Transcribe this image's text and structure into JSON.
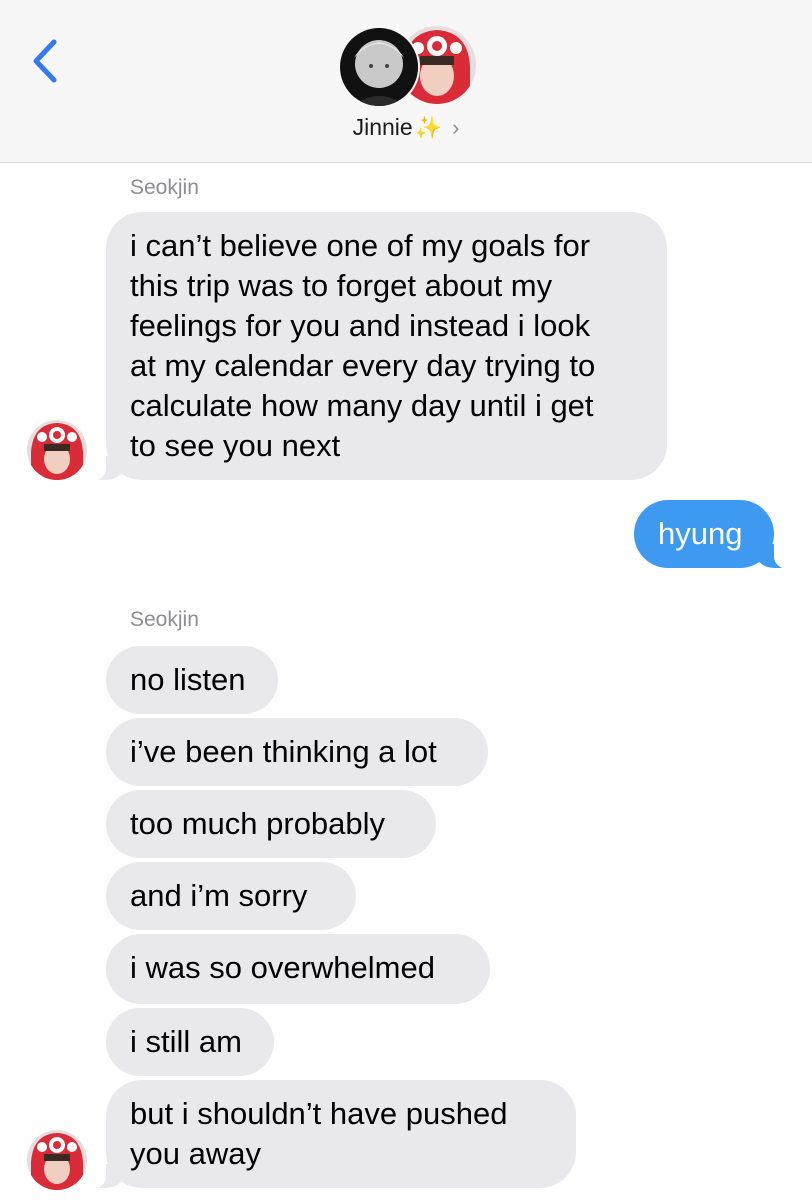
{
  "header": {
    "contact_name": "Jinnie",
    "sparkle": "✨",
    "chevron": "›",
    "back_icon": "chevron-left-icon"
  },
  "colors": {
    "header_bg": "#f7f7f7",
    "incoming_bubble": "#e9e9eb",
    "outgoing_bubble": "#3d9af0",
    "back_accent": "#3478f6",
    "sender_label": "#8e8e93"
  },
  "messages": {
    "group1_sender": "Seokjin",
    "group1_lines": [
      "i can’t believe one of my goals for",
      "this trip was to forget about my",
      "feelings for you and instead i look",
      "at my calendar every day trying to",
      "calculate how many day until i get",
      "to see you next"
    ],
    "sent_1": "hyung",
    "group2_sender": "Seokjin",
    "group2": [
      "no listen",
      "i’ve been thinking a lot",
      "too much probably",
      "and i’m sorry",
      "i was so overwhelmed",
      "i still am"
    ],
    "last_lines": [
      "but i shouldn’t have pushed",
      "you away"
    ]
  }
}
